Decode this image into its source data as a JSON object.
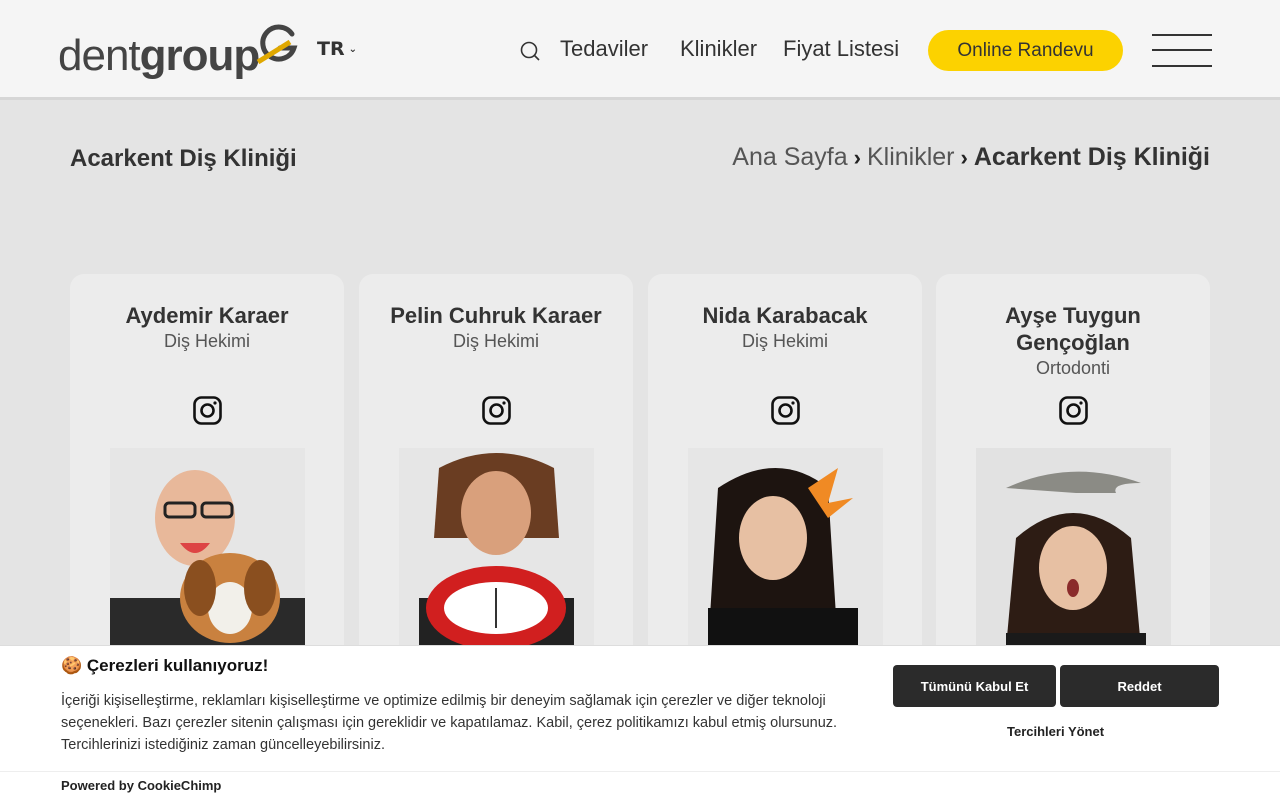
{
  "header": {
    "logo_text_light": "dent",
    "logo_text_bold": "group",
    "language": "TR",
    "nav": [
      "Tedaviler",
      "Klinikler",
      "Fiyat Listesi"
    ],
    "cta_label": "Online Randevu",
    "brand_color": "#fcd200"
  },
  "page": {
    "title": "Acarkent Diş Kliniği",
    "breadcrumb": {
      "home": "Ana Sayfa",
      "section": "Klinikler",
      "current": "Acarkent Diş Kliniği"
    }
  },
  "doctors": [
    {
      "name": "Aydemir Karaer",
      "role": "Diş Hekimi",
      "icon": "instagram-icon"
    },
    {
      "name": "Pelin Cuhruk Karaer",
      "role": "Diş Hekimi",
      "icon": "instagram-icon"
    },
    {
      "name": "Nida Karabacak",
      "role": "Diş Hekimi",
      "icon": "instagram-icon"
    },
    {
      "name": "Ayşe Tuygun Gençoğlan",
      "role": "Ortodonti",
      "icon": "instagram-icon"
    }
  ],
  "cookie": {
    "title": "🍪 Çerezleri kullanıyoruz!",
    "text": "İçeriği kişiselleştirme, reklamları kişiselleştirme ve optimize edilmiş bir deneyim sağlamak için çerezler ve diğer teknoloji seçenekleri. Bazı çerezler sitenin çalışması için gereklidir ve kapatılamaz. Kabil, çerez politikamızı kabul etmiş olursunuz. Tercihlerinizi istediğiniz zaman güncelleyebilirsiniz.",
    "accept_all": "Tümünü Kabul Et",
    "reject": "Reddet",
    "manage": "Tercihleri Yönet",
    "powered_prefix": "Powered by",
    "powered_brand": "CookieChimp"
  }
}
